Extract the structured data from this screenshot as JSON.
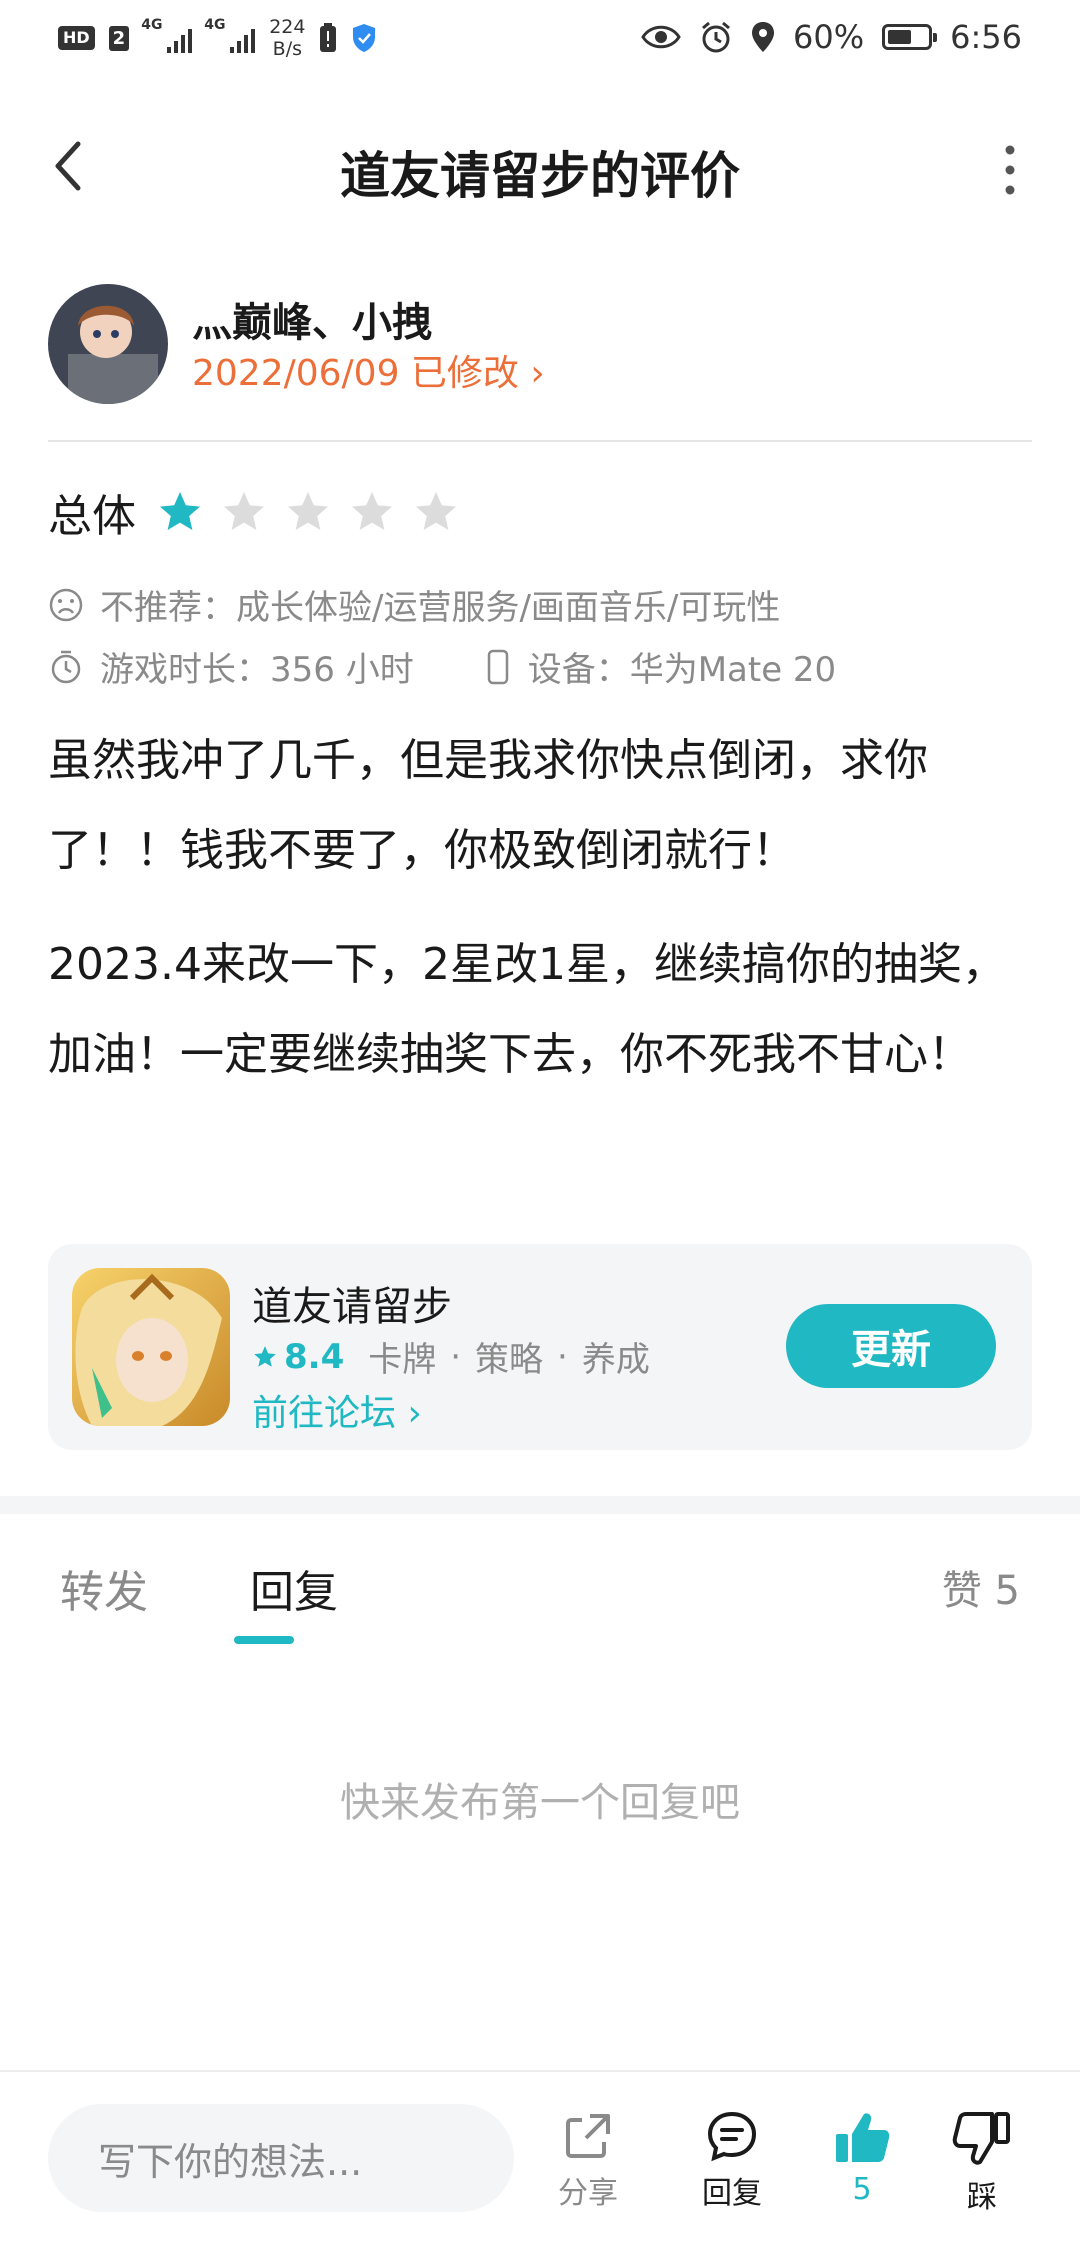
{
  "status_bar": {
    "hd": "HD",
    "sim": "2",
    "net1": "4G",
    "net2": "4G",
    "speed_value": "224",
    "speed_unit": "B/s",
    "battery": "60%",
    "time": "6:56",
    "battery_level": 0.6
  },
  "header": {
    "title": "道友请留步的评价"
  },
  "user": {
    "name": "灬巅峰、小拽",
    "date": "2022/06/09 已修改 ›"
  },
  "rating": {
    "label": "总体",
    "stars": 1,
    "max": 5
  },
  "meta": {
    "not_recommend": "不推荐：成长体验/运营服务/画面音乐/可玩性",
    "playtime": "游戏时长：356 小时",
    "device": "设备：华为Mate 20"
  },
  "review": {
    "paragraph1": "虽然我冲了几千，但是我求你快点倒闭，求你了！！钱我不要了，你极致倒闭就行！",
    "paragraph2": "2023.4来改一下，2星改1星，继续搞你的抽奖，加油！一定要继续抽奖下去，你不死我不甘心！"
  },
  "app": {
    "name": "道友请留步",
    "score": "8.4",
    "tags": [
      "卡牌",
      "策略",
      "养成"
    ],
    "forum": "前往论坛 ›",
    "button": "更新"
  },
  "tabs": {
    "forward": "转发",
    "reply": "回复",
    "likes": "赞 5"
  },
  "empty_text": "快来发布第一个回复吧",
  "bottom": {
    "placeholder": "写下你的想法...",
    "share": "分享",
    "reply": "回复",
    "like_count": "5",
    "dislike": "踩"
  },
  "colors": {
    "accent": "#1fb8c3",
    "date": "#ec6f3a",
    "muted": "#8a8a8a"
  }
}
